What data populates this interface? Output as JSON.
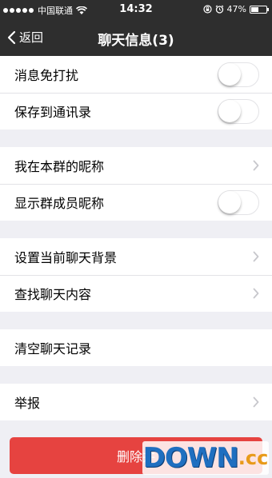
{
  "status_bar": {
    "carrier": "中国联通",
    "time": "14:32",
    "battery_percent": "47%",
    "battery_level": 0.47
  },
  "nav": {
    "back_label": "返回",
    "title": "聊天信息(3)"
  },
  "groups": [
    {
      "rows": [
        {
          "label": "消息免打扰",
          "control": "toggle",
          "on": false
        },
        {
          "label": "保存到通讯录",
          "control": "toggle",
          "on": false
        }
      ]
    },
    {
      "rows": [
        {
          "label": "我在本群的昵称",
          "control": "chevron"
        },
        {
          "label": "显示群成员昵称",
          "control": "toggle",
          "on": false
        }
      ]
    },
    {
      "rows": [
        {
          "label": "设置当前聊天背景",
          "control": "chevron"
        },
        {
          "label": "查找聊天内容",
          "control": "chevron"
        }
      ]
    },
    {
      "rows": [
        {
          "label": "清空聊天记录",
          "control": "none"
        }
      ]
    },
    {
      "rows": [
        {
          "label": "举报",
          "control": "chevron"
        }
      ]
    }
  ],
  "delete_button": {
    "label": "删除并"
  },
  "watermark": {
    "main": "DOWN",
    "suffix": ".cc"
  },
  "colors": {
    "nav_background": "#2e2e2e",
    "page_background": "#efeff4",
    "delete_red": "#e64340"
  }
}
